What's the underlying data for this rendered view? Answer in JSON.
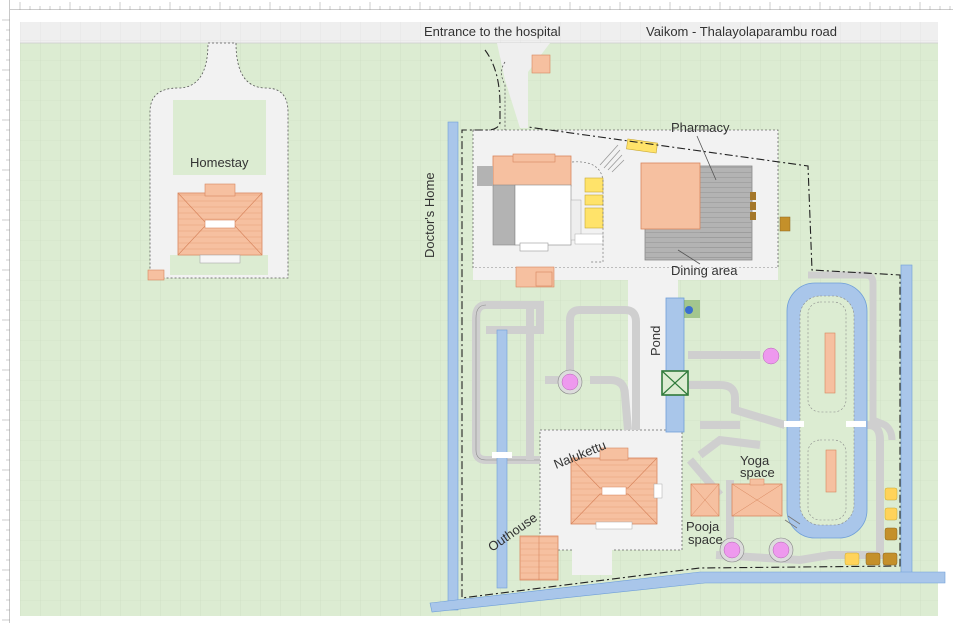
{
  "labels": {
    "entrance": "Entrance to the hospital",
    "road": "Vaikom - Thalayolaparambu road",
    "homestay": "Homestay",
    "pharmacy": "Pharmacy",
    "doctors_home": "Doctor's Home",
    "dining_area": "Dining area",
    "pond": "Pond",
    "nalukettu": "Nalukettu",
    "outhouse": "Outhouse",
    "yoga_space_1": "Yoga",
    "yoga_space_2": "space",
    "pooja_space_1": "Pooja",
    "pooja_space_2": "space"
  },
  "colors": {
    "grass": "#dcecd2",
    "road": "#efefef",
    "paved": "#f2f2f2",
    "building": "#f6c0a0",
    "roof_line": "#d8865e",
    "water": "#a9c6ea",
    "water_edge": "#6f9fd8",
    "path": "#d6d6d6",
    "path_edge": "#888888",
    "grey_building": "#b3b3b3",
    "yellow": "#ffe36a",
    "flower": "#ee99ee",
    "boundary": "#222222"
  }
}
